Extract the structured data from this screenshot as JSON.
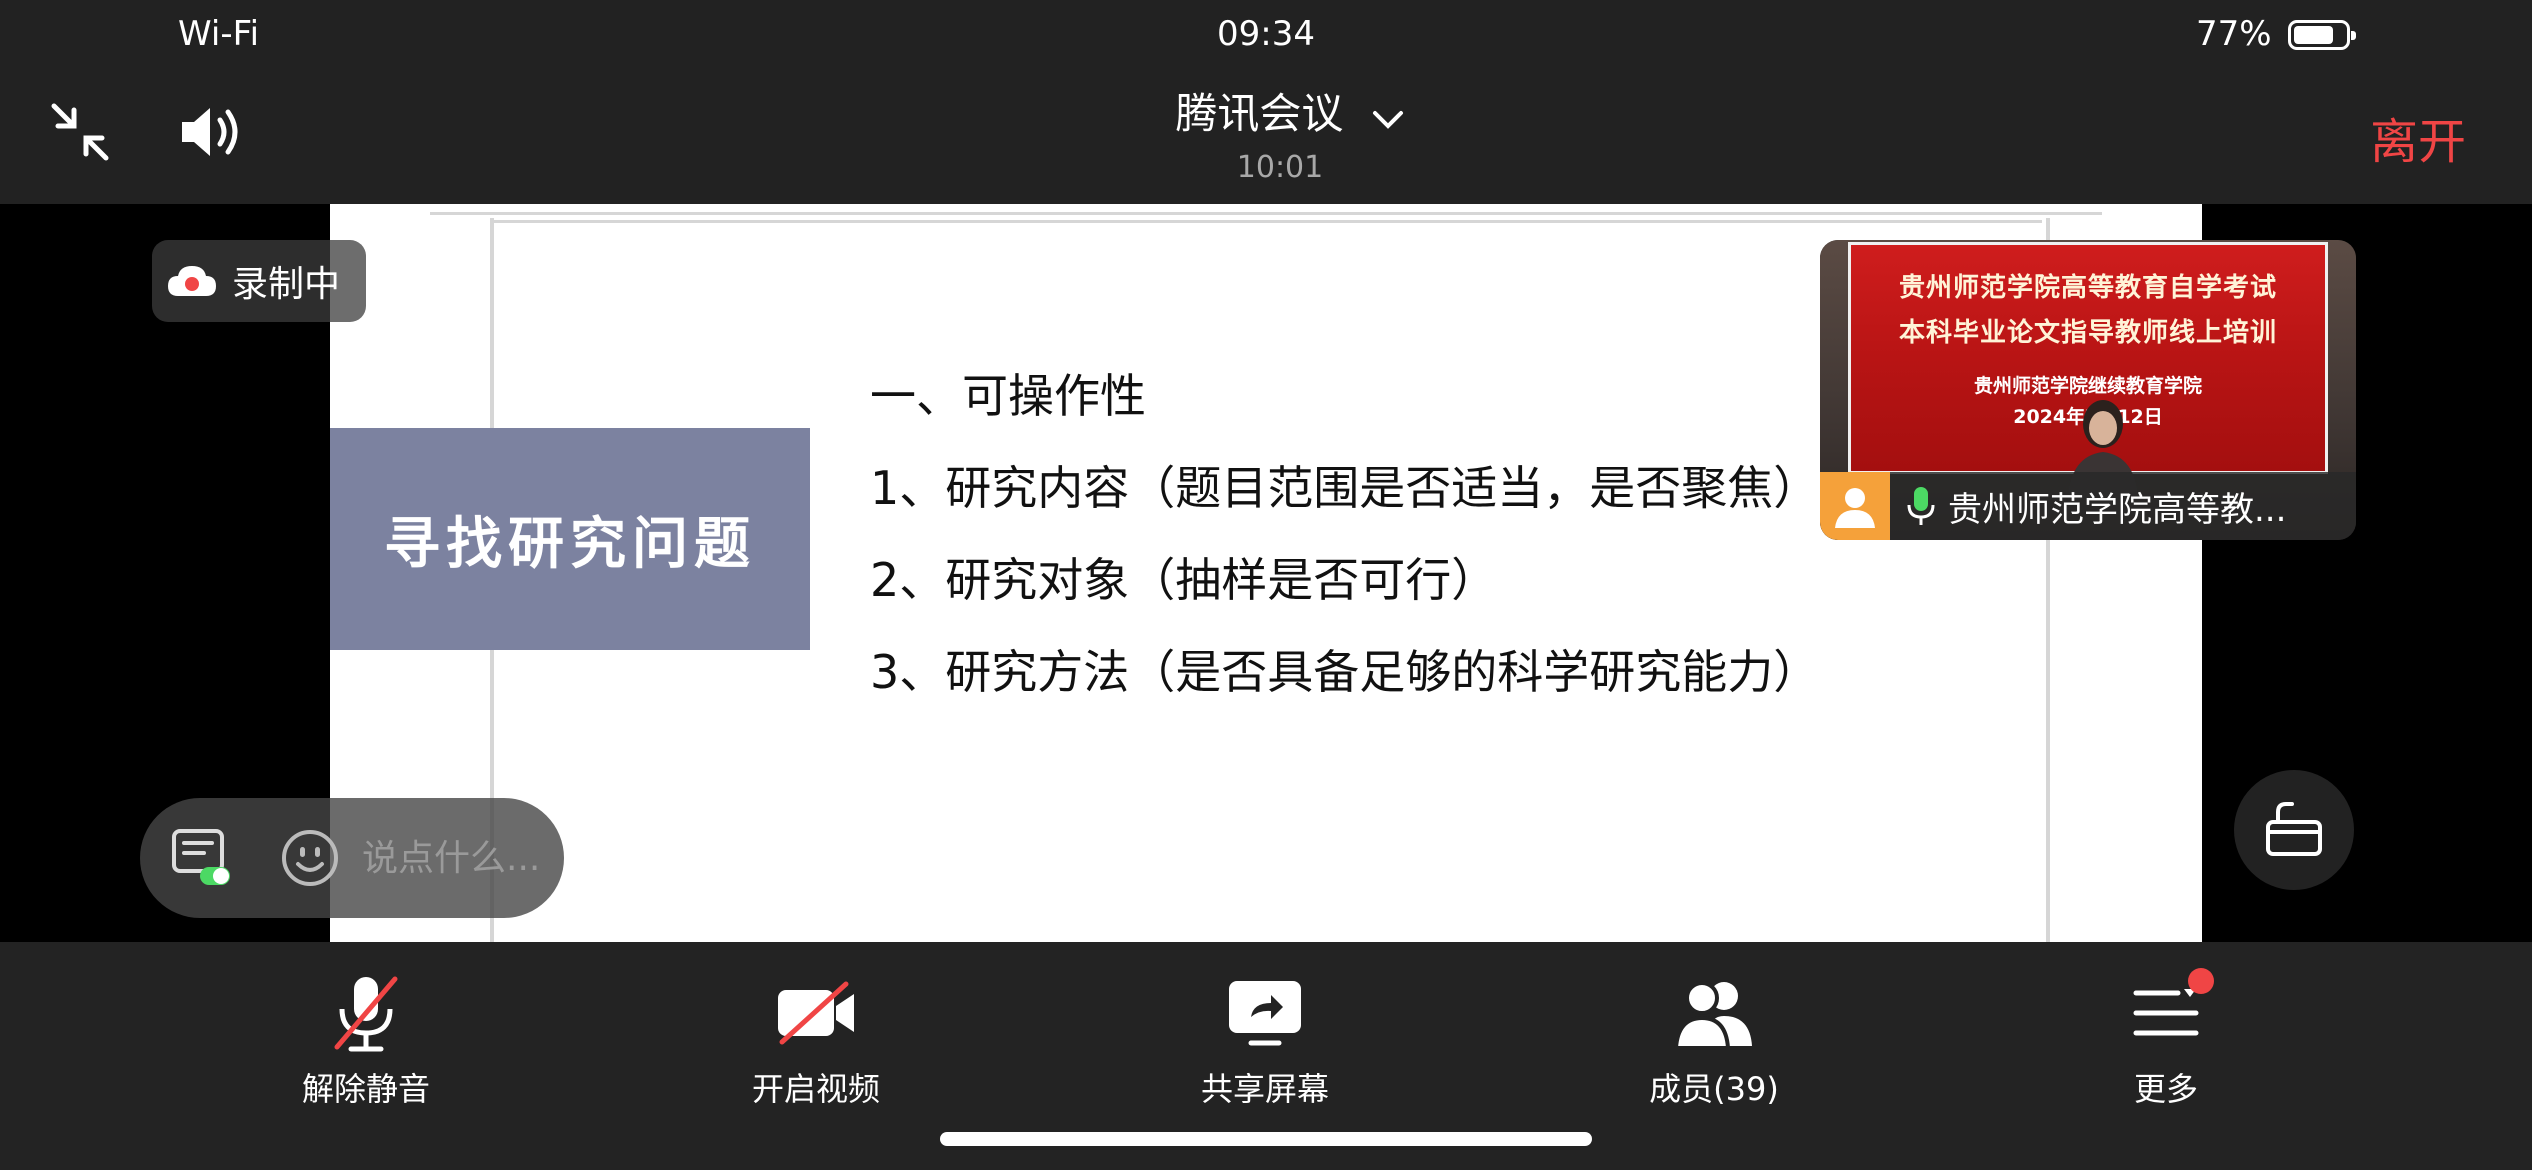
{
  "status_bar": {
    "network": "Wi-Fi",
    "time": "09:34",
    "battery_percent": "77%",
    "battery_level": 0.77
  },
  "header": {
    "title": "腾讯会议",
    "elapsed": "10:01",
    "leave_label": "离开",
    "icons": [
      "collapse-icon",
      "speaker-icon",
      "chevron-down-icon"
    ]
  },
  "recording": {
    "label": "录制中",
    "icon": "cloud-record-icon"
  },
  "slide": {
    "banner_title": "寻找研究问题",
    "heading": "一、可操作性",
    "items": [
      "1、研究内容（题目范围是否适当，是否聚焦）",
      "2、研究对象（抽样是否可行）",
      "3、研究方法（是否具备足够的科学研究能力）"
    ]
  },
  "video_tile": {
    "screen_text": {
      "line1": "贵州师范学院高等教育自学考试",
      "line2": "本科毕业论文指导教师线上培训",
      "line3": "贵州师范学院继续教育学院",
      "line4": "2024年7月12日"
    },
    "participant_name": "贵州师范学院高等教...",
    "accent_color": "#f5a13a"
  },
  "chat": {
    "placeholder": "说点什么..."
  },
  "toolbar": {
    "unmute_label": "解除静音",
    "video_label": "开启视频",
    "share_label": "共享屏幕",
    "members_label": "成员(39)",
    "more_label": "更多",
    "alert_color": "#f04545"
  }
}
